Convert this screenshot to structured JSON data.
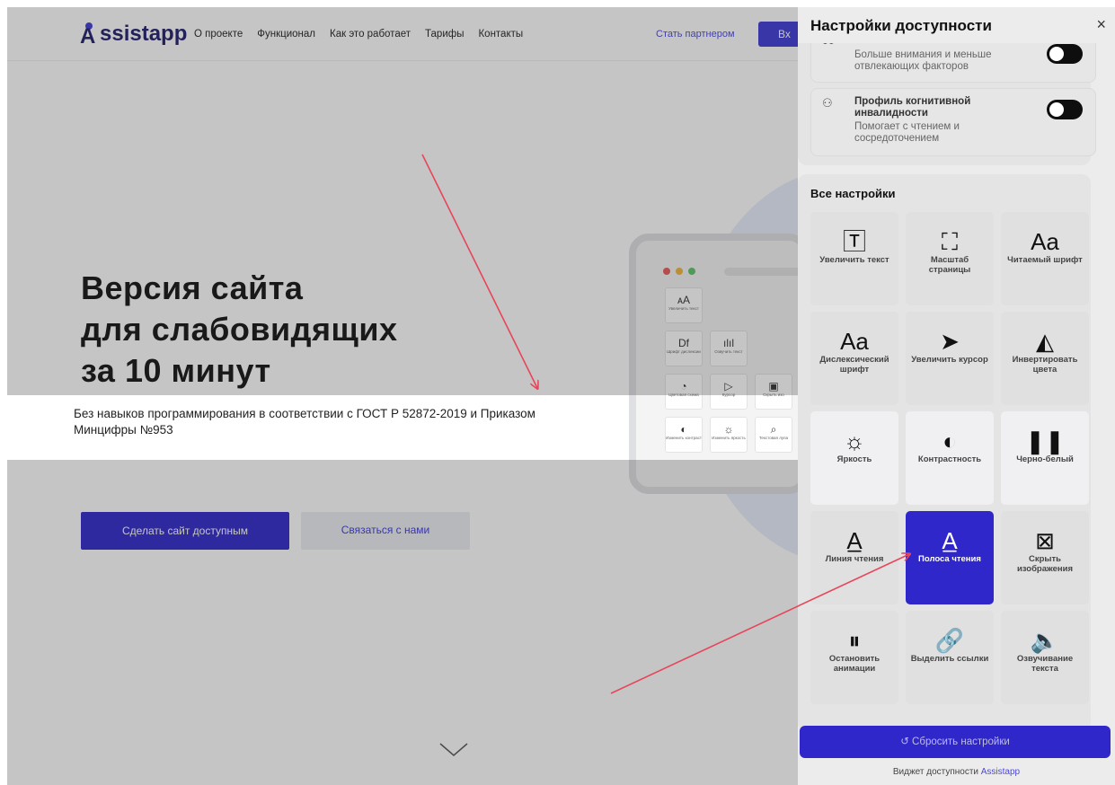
{
  "site": {
    "logo": "Assistapp",
    "nav": [
      "О проекте",
      "Функционал",
      "Как это работает",
      "Тарифы",
      "Контакты"
    ],
    "partner_link": "Стать партнером",
    "login_button": "Вх",
    "hero_title_lines": [
      "Версия сайта",
      "для слабовидящих",
      "за 10 минут"
    ],
    "hero_subtitle_line1": "Без навыков программирования в соответствии с ГОСТ Р 52872-2019 и Приказом",
    "hero_subtitle_line2": "Минцифры №953",
    "primary_button": "Сделать сайт доступным",
    "secondary_button": "Связаться с нами",
    "mock_tiles": [
      {
        "icon": "ᴀA",
        "label": "Увеличить текст"
      },
      {
        "icon": "",
        "label": ""
      },
      {
        "icon": "",
        "label": ""
      },
      {
        "icon": "Df",
        "label": "Шрифт дислексии"
      },
      {
        "icon": "ılıl",
        "label": "Озвучить текст"
      },
      {
        "icon": "",
        "label": ""
      },
      {
        "icon": "◔",
        "label": "Цветовая схема"
      },
      {
        "icon": "▷",
        "label": "Курсор"
      },
      {
        "icon": "▣",
        "label": "Скрыть изо"
      },
      {
        "icon": "◐",
        "label": "Изменить контраст"
      },
      {
        "icon": "☼",
        "label": "Изменить яркость"
      },
      {
        "icon": "⌕",
        "label": "Текстовая лупа"
      }
    ]
  },
  "panel": {
    "title": "Настройки доступности",
    "close_icon": "×",
    "profiles": [
      {
        "icon": "ಠಠ",
        "name": "",
        "description": "Больше внимания и меньше отвлекающих факторов",
        "enabled": true
      },
      {
        "icon": "⚇",
        "name": "Профиль когнитивной инвалидности",
        "description": "Помогает с чтением и сосредоточением",
        "enabled": true
      }
    ],
    "all_settings_title": "Все настройки",
    "tiles": [
      {
        "icon": "🅃",
        "label": "Увеличить текст",
        "state": "normal"
      },
      {
        "icon": "⛶",
        "label": "Масштаб страницы",
        "state": "normal"
      },
      {
        "icon": "Aa",
        "label": "Читаемый шрифт",
        "state": "normal"
      },
      {
        "icon": "Aa",
        "label": "Дислексический шрифт",
        "state": "normal"
      },
      {
        "icon": "➤",
        "label": "Увеличить курсор",
        "state": "normal"
      },
      {
        "icon": "◭",
        "label": "Инвертировать цвета",
        "state": "normal"
      },
      {
        "icon": "☼",
        "label": "Яркость",
        "state": "white"
      },
      {
        "icon": "◐",
        "label": "Контрастность",
        "state": "white"
      },
      {
        "icon": "❚❚",
        "label": "Черно-белый",
        "state": "white"
      },
      {
        "icon": "A̲",
        "label": "Линия чтения",
        "state": "normal"
      },
      {
        "icon": "A̲",
        "label": "Полоса чтения",
        "state": "active"
      },
      {
        "icon": "⊠",
        "label": "Скрыть изображения",
        "state": "normal"
      },
      {
        "icon": "⏸",
        "label": "Остановить анимации",
        "state": "normal"
      },
      {
        "icon": "🔗",
        "label": "Выделить ссылки",
        "state": "normal"
      },
      {
        "icon": "🔈",
        "label": "Озвучивание текста",
        "state": "normal"
      }
    ],
    "reset_button": "Сбросить настройки",
    "reset_icon": "↺",
    "footer_prefix": "Виджет доступности ",
    "footer_brand": "Assistapp"
  },
  "colors": {
    "accent": "#2f27c9",
    "arrow": "#e8455a"
  }
}
